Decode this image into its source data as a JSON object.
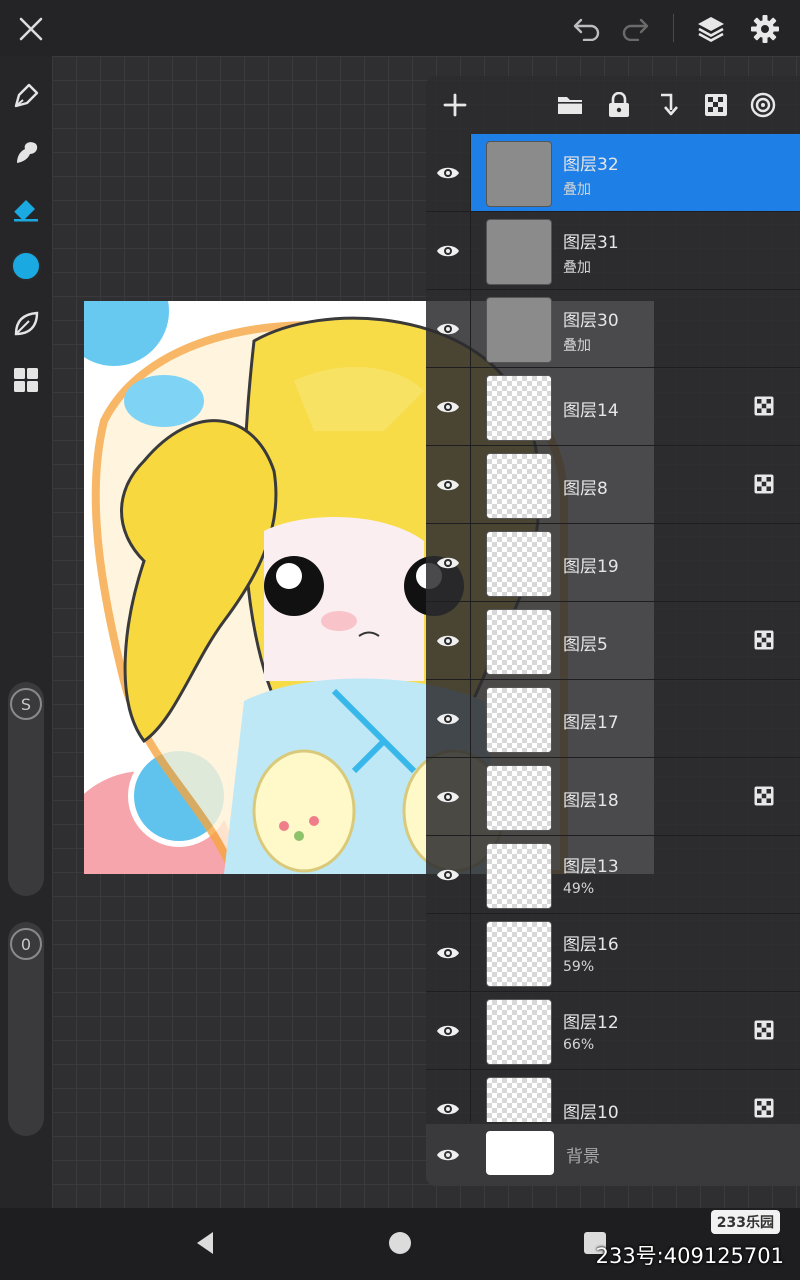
{
  "toolbar_top": {
    "icons": [
      "close-icon",
      "undo-icon",
      "redo-icon",
      "layers-icon",
      "settings-icon"
    ]
  },
  "tools_left": {
    "icons": [
      "pen-icon",
      "smudge-icon",
      "eraser-icon",
      "color-swatch",
      "leaf-icon",
      "grid-menu-icon"
    ],
    "active_color": "#1aa9e0"
  },
  "sliders": {
    "size_label": "S",
    "opacity_label": "0"
  },
  "layer_panel": {
    "toolbar_icons": [
      "add-icon",
      "folder-icon",
      "lock-icon",
      "merge-down-icon",
      "alpha-lock-icon",
      "target-icon"
    ],
    "layers": [
      {
        "name": "图层32",
        "sub": "叠加",
        "selected": true,
        "alpha_lock": false,
        "thumb": "gray"
      },
      {
        "name": "图层31",
        "sub": "叠加",
        "selected": false,
        "alpha_lock": false,
        "thumb": "gray"
      },
      {
        "name": "图层30",
        "sub": "叠加",
        "selected": false,
        "alpha_lock": false,
        "thumb": "gray"
      },
      {
        "name": "图层14",
        "sub": "",
        "selected": false,
        "alpha_lock": true,
        "thumb": "checker"
      },
      {
        "name": "图层8",
        "sub": "",
        "selected": false,
        "alpha_lock": true,
        "thumb": "checker"
      },
      {
        "name": "图层19",
        "sub": "",
        "selected": false,
        "alpha_lock": false,
        "thumb": "checker"
      },
      {
        "name": "图层5",
        "sub": "",
        "selected": false,
        "alpha_lock": true,
        "thumb": "checker"
      },
      {
        "name": "图层17",
        "sub": "",
        "selected": false,
        "alpha_lock": false,
        "thumb": "checker"
      },
      {
        "name": "图层18",
        "sub": "",
        "selected": false,
        "alpha_lock": true,
        "thumb": "checker"
      },
      {
        "name": "图层13",
        "sub": "49%",
        "selected": false,
        "alpha_lock": false,
        "thumb": "checker"
      },
      {
        "name": "图层16",
        "sub": "59%",
        "selected": false,
        "alpha_lock": false,
        "thumb": "checker"
      },
      {
        "name": "图层12",
        "sub": "66%",
        "selected": false,
        "alpha_lock": true,
        "thumb": "checker"
      },
      {
        "name": "图层10",
        "sub": "",
        "selected": false,
        "alpha_lock": true,
        "thumb": "checker"
      }
    ],
    "background_layer": {
      "name": "背景"
    }
  },
  "watermark": {
    "badge": "233乐园",
    "id_text": "233号:409125701"
  },
  "colors": {
    "accent_blue": "#1e7fe6",
    "panel_bg": "#2c2c2e"
  }
}
